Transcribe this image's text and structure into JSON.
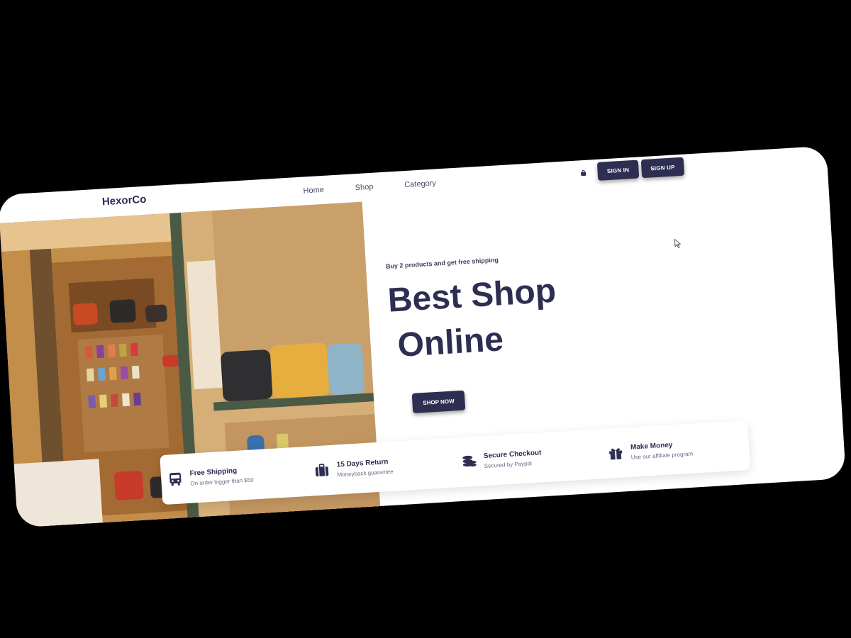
{
  "brand": "HexorCo",
  "nav": {
    "links": [
      {
        "label": "Home"
      },
      {
        "label": "Shop"
      },
      {
        "label": "Category"
      }
    ],
    "signin_label": "SIGN IN",
    "signup_label": "SIGN UP"
  },
  "hero": {
    "promo": "Buy 2 products and get free shipping",
    "headline_line1": "Best Shop",
    "headline_line2": "Online",
    "cta_label": "SHOP NOW"
  },
  "features": [
    {
      "icon": "bus-icon",
      "title": "Free Shipping",
      "subtitle": "On order bigger than $50"
    },
    {
      "icon": "suitcase-icon",
      "title": "15 Days Return",
      "subtitle": "Moneyback guarantee"
    },
    {
      "icon": "coins-icon",
      "title": "Secure Checkout",
      "subtitle": "Secured by Paypal"
    },
    {
      "icon": "gift-icon",
      "title": "Make Money",
      "subtitle": "Use our affiliate program"
    }
  ],
  "colors": {
    "primary": "#2d2e52",
    "background": "#ffffff",
    "page_background": "#000000"
  }
}
